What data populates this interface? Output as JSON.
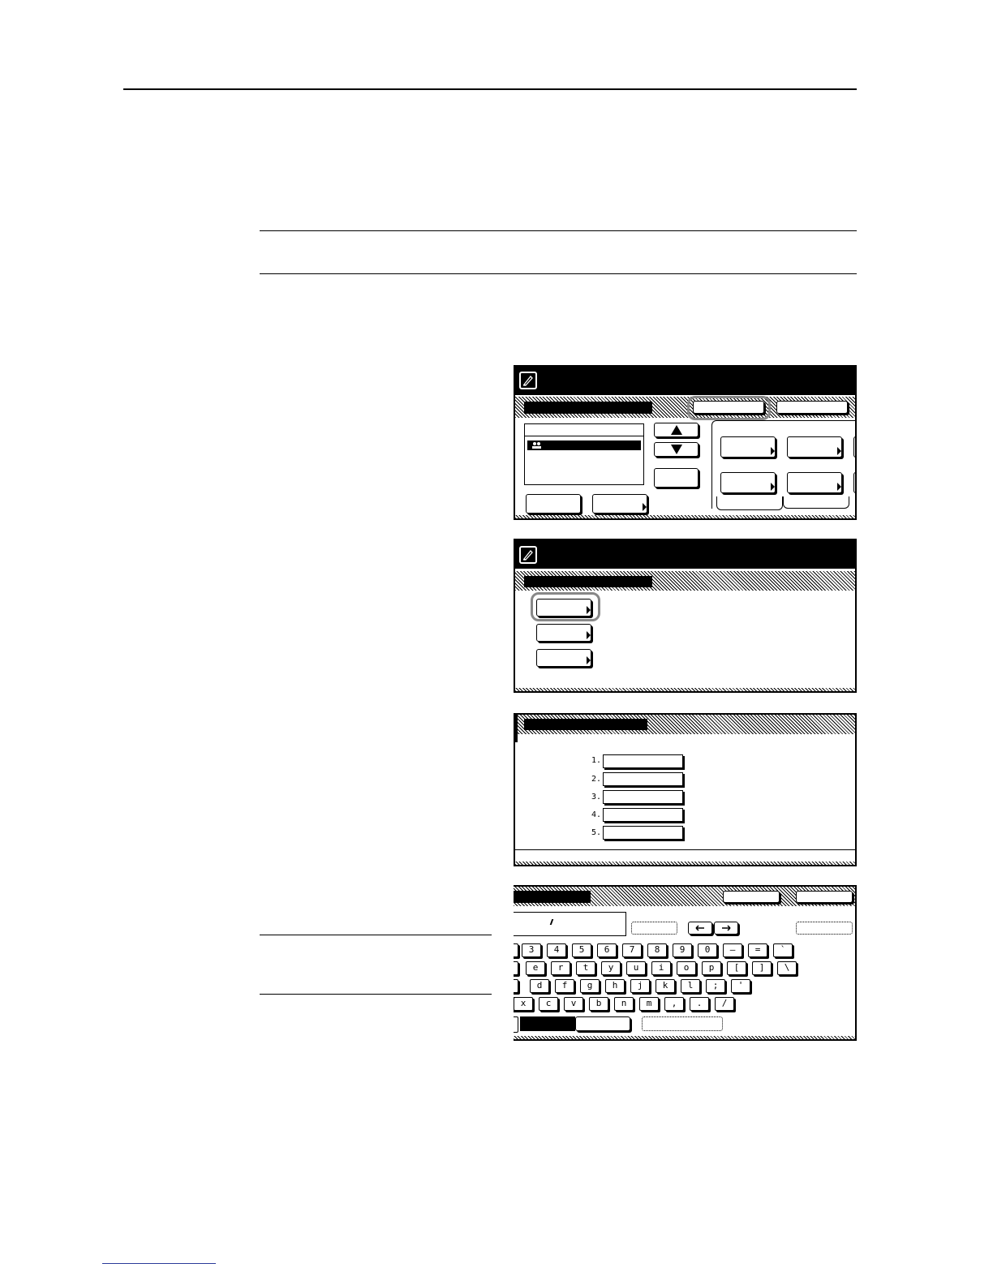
{
  "screens": {
    "keyboard": {
      "row1": [
        "3",
        "4",
        "5",
        "6",
        "7",
        "8",
        "9",
        "0",
        "–",
        "=",
        "`"
      ],
      "row2": [
        "e",
        "r",
        "t",
        "y",
        "u",
        "i",
        "o",
        "p",
        "[",
        "]",
        "\\"
      ],
      "row3": [
        "d",
        "f",
        "g",
        "h",
        "j",
        "k",
        "l",
        ";",
        "'"
      ],
      "row4": [
        "x",
        "c",
        "v",
        "b",
        "n",
        "m",
        ",",
        ".",
        "/"
      ]
    },
    "numbered_list": {
      "labels": [
        "1.",
        "2.",
        "3.",
        "4.",
        "5."
      ]
    }
  }
}
